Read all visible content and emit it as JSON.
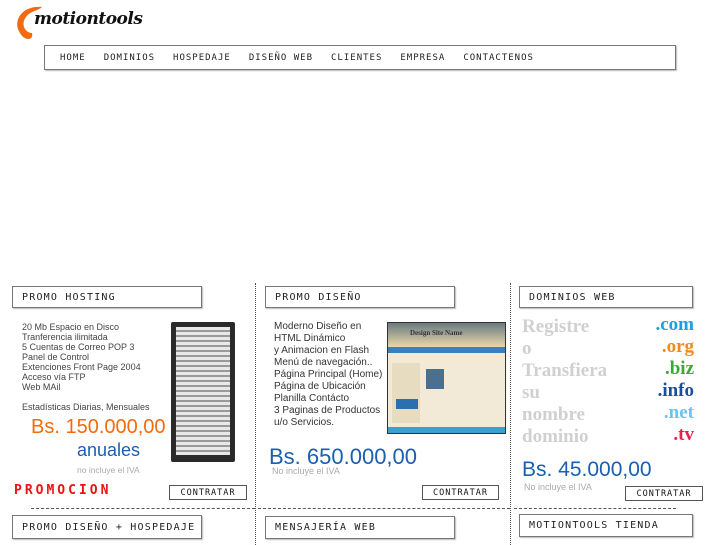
{
  "brand": {
    "name": "motiontools",
    "accent": "#f26b10"
  },
  "nav": [
    "HOME",
    "DOMINIOS",
    "HOSPEDAJE",
    "DISEÑO WEB",
    "CLIENTES",
    "EMPRESA",
    "CONTACTENOS"
  ],
  "hosting": {
    "title": "PROMO HOSTING",
    "features": [
      "20 Mb Espacio en Disco",
      "Tranferencia ilimitada",
      "5 Cuentas de Correo POP 3",
      "Panel de Control",
      "Extenciones Front Page 2004",
      "Acceso vía FTP",
      "Web MAil",
      "",
      "Estadísticas Diarias, Mensuales"
    ],
    "price": "Bs. 150.000,00",
    "period": "anuales",
    "iva": "no incluye el IVA",
    "promo": "PROMOCION",
    "button": "CONTRATAR"
  },
  "design": {
    "title": "PROMO DISEÑO",
    "features": [
      "Moderno Diseño en",
      "HTML Dinámico",
      "y Animacion en Flash",
      "Menú de navegación..",
      "Página Principal (Home)",
      "Página de Ubicación",
      "Planilla Contácto",
      "3 Paginas de Productos",
      "u/o Servicios."
    ],
    "preview_title": "Design Site Name",
    "price": "Bs. 650.000,00",
    "iva": "No incluye el IVA",
    "button": "CONTRATAR"
  },
  "domains": {
    "title": "DOMINIOS WEB",
    "words": [
      "Registre",
      "o",
      "Transfiera",
      "su",
      "nombre",
      "dominio"
    ],
    "tlds": [
      {
        "label": ".com",
        "color": "#1aa0e0"
      },
      {
        "label": ".org",
        "color": "#f08a20"
      },
      {
        "label": ".biz",
        "color": "#3aa93a"
      },
      {
        "label": ".info",
        "color": "#1a4fa0"
      },
      {
        "label": ".net",
        "color": "#6cc4ee"
      },
      {
        "label": ".tv",
        "color": "#e8204a"
      }
    ],
    "price": "Bs. 45.000,00",
    "iva": "No incluye el IVA",
    "button": "CONTRATAR"
  },
  "bottom": {
    "combo": "PROMO DISEÑO + HOSPEDAJE",
    "mail": "MENSAJERÍA WEB",
    "store": "MOTIONTOOLS TIENDA"
  }
}
